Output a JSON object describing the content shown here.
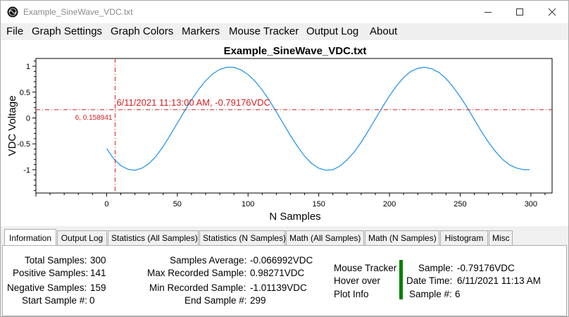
{
  "window": {
    "title": "Example_SineWave_VDC.txt"
  },
  "menu": [
    "File",
    "Graph Settings",
    "Graph Colors",
    "Markers",
    "Mouse Tracker",
    "Output Log",
    "About"
  ],
  "chart_data": {
    "type": "line",
    "title": "Example_SineWave_VDC.txt",
    "xlabel": "N Samples",
    "ylabel": "VDC Voltage",
    "xlim": [
      -50,
      315
    ],
    "ylim": [
      -1.45,
      1.15
    ],
    "xticks": [
      0,
      50,
      100,
      150,
      200,
      250,
      300
    ],
    "yticks": [
      1,
      0.5,
      0,
      -0.5,
      -1
    ],
    "ytick_labels": [
      "1",
      "0.5",
      "0",
      "-0.5",
      "-1"
    ],
    "series": [
      {
        "color": "#1e90e6",
        "x": [
          0,
          5,
          10,
          15,
          20,
          25,
          30,
          35,
          40,
          45,
          50,
          55,
          60,
          65,
          70,
          75,
          80,
          85,
          90,
          95,
          100,
          105,
          110,
          115,
          120,
          125,
          130,
          135,
          140,
          145,
          150,
          155,
          160,
          165,
          170,
          175,
          180,
          185,
          190,
          195,
          200,
          205,
          210,
          215,
          220,
          225,
          230,
          235,
          240,
          245,
          250,
          255,
          260,
          265,
          270,
          275,
          280,
          285,
          290,
          295,
          299
        ],
        "y": [
          -0.59,
          -0.79,
          -0.92,
          -0.99,
          -1.01,
          -0.97,
          -0.88,
          -0.74,
          -0.55,
          -0.33,
          -0.1,
          0.13,
          0.35,
          0.55,
          0.72,
          0.85,
          0.94,
          0.98,
          0.98,
          0.93,
          0.84,
          0.71,
          0.54,
          0.34,
          0.12,
          -0.11,
          -0.34,
          -0.55,
          -0.74,
          -0.88,
          -0.97,
          -1.01,
          -1.0,
          -0.93,
          -0.81,
          -0.66,
          -0.47,
          -0.25,
          -0.02,
          0.21,
          0.43,
          0.62,
          0.78,
          0.9,
          0.96,
          0.98,
          0.95,
          0.88,
          0.76,
          0.6,
          0.41,
          0.2,
          -0.03,
          -0.26,
          -0.47,
          -0.65,
          -0.8,
          -0.91,
          -0.97,
          -1.0,
          -1.0
        ]
      }
    ],
    "crosshair": {
      "x": 6,
      "y": 0.158941,
      "color": "#d42020",
      "label": "6/11/2021 11:13:00 AM, -0.79176VDC",
      "axis_label": "6, 0.158941"
    },
    "grid": false
  },
  "tabs": [
    "Information",
    "Output Log",
    "Statistics (All Samples)",
    "Statistics (N Samples)",
    "Math (All Samples)",
    "Math (N Samples)",
    "Histogram",
    "Misc"
  ],
  "active_tab": "Information",
  "info": {
    "total_samples_label": "Total Samples:",
    "total_samples": "300",
    "positive_samples_label": "Positive Samples:",
    "positive_samples": "141",
    "negative_samples_label": "Negative Samples:",
    "negative_samples": "159",
    "start_sample_label": "Start Sample #:",
    "start_sample": "0",
    "samples_average_label": "Samples Average:",
    "samples_average": "-0.066992VDC",
    "max_sample_label": "Max Recorded Sample:",
    "max_sample": "0.98271VDC",
    "min_sample_label": "Min Recorded Sample:",
    "min_sample": "-1.01139VDC",
    "end_sample_label": "End Sample #:",
    "end_sample": "299",
    "tracker_line1": "Mouse Tracker",
    "tracker_line2": "Hover over",
    "tracker_line3": "Plot Info",
    "tracker_sample_label": "Sample:",
    "tracker_sample": "-0.79176VDC",
    "tracker_datetime_label": "Date Time:",
    "tracker_datetime": "6/11/2021 11:13 AM",
    "tracker_index_label": "Sample #:",
    "tracker_index": "6"
  }
}
